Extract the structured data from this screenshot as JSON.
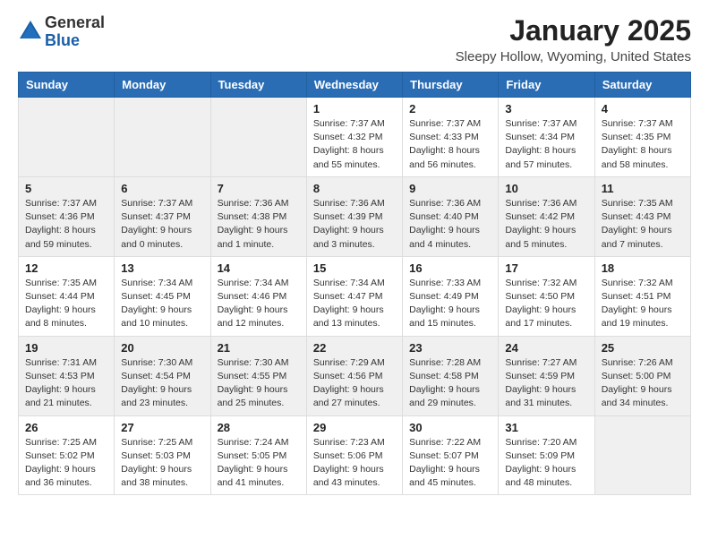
{
  "logo": {
    "general": "General",
    "blue": "Blue"
  },
  "header": {
    "month": "January 2025",
    "location": "Sleepy Hollow, Wyoming, United States"
  },
  "weekdays": [
    "Sunday",
    "Monday",
    "Tuesday",
    "Wednesday",
    "Thursday",
    "Friday",
    "Saturday"
  ],
  "weeks": [
    [
      {
        "day": "",
        "info": ""
      },
      {
        "day": "",
        "info": ""
      },
      {
        "day": "",
        "info": ""
      },
      {
        "day": "1",
        "info": "Sunrise: 7:37 AM\nSunset: 4:32 PM\nDaylight: 8 hours\nand 55 minutes."
      },
      {
        "day": "2",
        "info": "Sunrise: 7:37 AM\nSunset: 4:33 PM\nDaylight: 8 hours\nand 56 minutes."
      },
      {
        "day": "3",
        "info": "Sunrise: 7:37 AM\nSunset: 4:34 PM\nDaylight: 8 hours\nand 57 minutes."
      },
      {
        "day": "4",
        "info": "Sunrise: 7:37 AM\nSunset: 4:35 PM\nDaylight: 8 hours\nand 58 minutes."
      }
    ],
    [
      {
        "day": "5",
        "info": "Sunrise: 7:37 AM\nSunset: 4:36 PM\nDaylight: 8 hours\nand 59 minutes."
      },
      {
        "day": "6",
        "info": "Sunrise: 7:37 AM\nSunset: 4:37 PM\nDaylight: 9 hours\nand 0 minutes."
      },
      {
        "day": "7",
        "info": "Sunrise: 7:36 AM\nSunset: 4:38 PM\nDaylight: 9 hours\nand 1 minute."
      },
      {
        "day": "8",
        "info": "Sunrise: 7:36 AM\nSunset: 4:39 PM\nDaylight: 9 hours\nand 3 minutes."
      },
      {
        "day": "9",
        "info": "Sunrise: 7:36 AM\nSunset: 4:40 PM\nDaylight: 9 hours\nand 4 minutes."
      },
      {
        "day": "10",
        "info": "Sunrise: 7:36 AM\nSunset: 4:42 PM\nDaylight: 9 hours\nand 5 minutes."
      },
      {
        "day": "11",
        "info": "Sunrise: 7:35 AM\nSunset: 4:43 PM\nDaylight: 9 hours\nand 7 minutes."
      }
    ],
    [
      {
        "day": "12",
        "info": "Sunrise: 7:35 AM\nSunset: 4:44 PM\nDaylight: 9 hours\nand 8 minutes."
      },
      {
        "day": "13",
        "info": "Sunrise: 7:34 AM\nSunset: 4:45 PM\nDaylight: 9 hours\nand 10 minutes."
      },
      {
        "day": "14",
        "info": "Sunrise: 7:34 AM\nSunset: 4:46 PM\nDaylight: 9 hours\nand 12 minutes."
      },
      {
        "day": "15",
        "info": "Sunrise: 7:34 AM\nSunset: 4:47 PM\nDaylight: 9 hours\nand 13 minutes."
      },
      {
        "day": "16",
        "info": "Sunrise: 7:33 AM\nSunset: 4:49 PM\nDaylight: 9 hours\nand 15 minutes."
      },
      {
        "day": "17",
        "info": "Sunrise: 7:32 AM\nSunset: 4:50 PM\nDaylight: 9 hours\nand 17 minutes."
      },
      {
        "day": "18",
        "info": "Sunrise: 7:32 AM\nSunset: 4:51 PM\nDaylight: 9 hours\nand 19 minutes."
      }
    ],
    [
      {
        "day": "19",
        "info": "Sunrise: 7:31 AM\nSunset: 4:53 PM\nDaylight: 9 hours\nand 21 minutes."
      },
      {
        "day": "20",
        "info": "Sunrise: 7:30 AM\nSunset: 4:54 PM\nDaylight: 9 hours\nand 23 minutes."
      },
      {
        "day": "21",
        "info": "Sunrise: 7:30 AM\nSunset: 4:55 PM\nDaylight: 9 hours\nand 25 minutes."
      },
      {
        "day": "22",
        "info": "Sunrise: 7:29 AM\nSunset: 4:56 PM\nDaylight: 9 hours\nand 27 minutes."
      },
      {
        "day": "23",
        "info": "Sunrise: 7:28 AM\nSunset: 4:58 PM\nDaylight: 9 hours\nand 29 minutes."
      },
      {
        "day": "24",
        "info": "Sunrise: 7:27 AM\nSunset: 4:59 PM\nDaylight: 9 hours\nand 31 minutes."
      },
      {
        "day": "25",
        "info": "Sunrise: 7:26 AM\nSunset: 5:00 PM\nDaylight: 9 hours\nand 34 minutes."
      }
    ],
    [
      {
        "day": "26",
        "info": "Sunrise: 7:25 AM\nSunset: 5:02 PM\nDaylight: 9 hours\nand 36 minutes."
      },
      {
        "day": "27",
        "info": "Sunrise: 7:25 AM\nSunset: 5:03 PM\nDaylight: 9 hours\nand 38 minutes."
      },
      {
        "day": "28",
        "info": "Sunrise: 7:24 AM\nSunset: 5:05 PM\nDaylight: 9 hours\nand 41 minutes."
      },
      {
        "day": "29",
        "info": "Sunrise: 7:23 AM\nSunset: 5:06 PM\nDaylight: 9 hours\nand 43 minutes."
      },
      {
        "day": "30",
        "info": "Sunrise: 7:22 AM\nSunset: 5:07 PM\nDaylight: 9 hours\nand 45 minutes."
      },
      {
        "day": "31",
        "info": "Sunrise: 7:20 AM\nSunset: 5:09 PM\nDaylight: 9 hours\nand 48 minutes."
      },
      {
        "day": "",
        "info": ""
      }
    ]
  ]
}
